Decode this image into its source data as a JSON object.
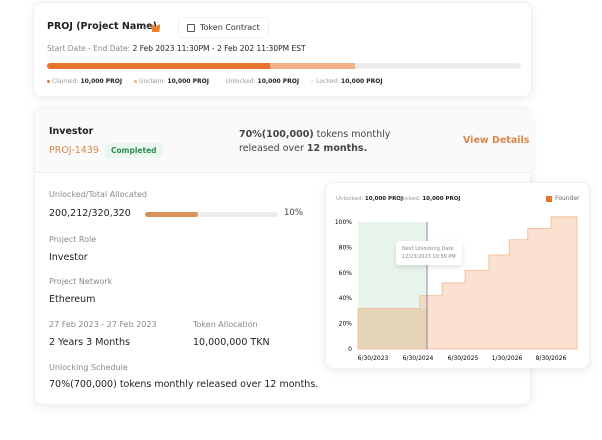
{
  "top_card": {
    "project_name": "PROJ (Project Name)",
    "add_wallet": "+",
    "token_contract": "Token Contract",
    "dates_label": "Start Date - End Date:",
    "dates_value": "2 Feb 2023 11:30PM - 2 Feb 202 11:30PM EST",
    "progress": {
      "claimed_pct": 47,
      "unclaim_pct": 18
    },
    "legend": [
      {
        "label": "Claimed:",
        "value": "10,000 PROJ",
        "color": "#e8712c"
      },
      {
        "label": "Unclaim:",
        "value": "10,000 PROJ",
        "color": "#f2b285"
      },
      {
        "label": "Unlocked:",
        "value": "10,000 PROJ",
        "color": "#ffffff"
      },
      {
        "label": "Locked:",
        "value": "10,000 PROJ",
        "color": "#ececec"
      }
    ]
  },
  "detail_card": {
    "role_title": "Investor",
    "project_id": "PROJ-1439",
    "status": "Completed",
    "summary_bold1": "70%(100,000)",
    "summary_text1": " tokens monthly",
    "summary_text2": "released over ",
    "summary_bold2": "12 months.",
    "view_details": "View Details",
    "unlocked_label": "Unlocked/Total Allocated",
    "unlocked_value": "200,212/320,320",
    "unlocked_pct_label": "10%",
    "unlocked_pct": 10,
    "project_role_label": "Project Role",
    "project_role": "Investor",
    "network_label": "Project Network",
    "network": "Ethereum",
    "period_label": "27 Feb 2023 - 27 Feb 2023",
    "period": "2 Years 3 Months",
    "allocation_label": "Token Allocation",
    "allocation": "10,000,000 TKN",
    "schedule_label": "Unlocking Schedule",
    "schedule": "70%(700,000) tokens monthly released over 12 months."
  },
  "chart_card": {
    "unlocked_label": "Unlocked:",
    "unlocked_value": "10,000 PROJ",
    "locked_label": "Locked:",
    "locked_value": "10,000 PROJ",
    "tooltip_title": "Next Unlocking Date",
    "tooltip_value": "12/23/2023 10:59 PM"
  },
  "chart_data": {
    "type": "area",
    "step": true,
    "legend": [
      {
        "name": "Founder",
        "color": "#e8712c"
      }
    ],
    "legend_position": "top-right",
    "y_ticks": [
      "0",
      "20%",
      "40%",
      "60%",
      "80%",
      "100%"
    ],
    "ylim": [
      0,
      100
    ],
    "x_ticks": [
      "6/30/2023",
      "6/30/2024",
      "6/30/2025",
      "1/30/2026",
      "8/30/2026"
    ],
    "series": [
      {
        "name": "Founder",
        "color": "#f8c9a8",
        "points": [
          {
            "x": "2023-02-28",
            "y": 32
          },
          {
            "x": "2024-07-15",
            "y": 42
          },
          {
            "x": "2025-01-12",
            "y": 52
          },
          {
            "x": "2025-07-10",
            "y": 62
          },
          {
            "x": "2025-11-03",
            "y": 74
          },
          {
            "x": "2026-02-10",
            "y": 86
          },
          {
            "x": "2026-05-10",
            "y": 95
          },
          {
            "x": "2026-08-30",
            "y": 104
          }
        ]
      }
    ],
    "unlocked_region_color": "#e6f4ec"
  }
}
